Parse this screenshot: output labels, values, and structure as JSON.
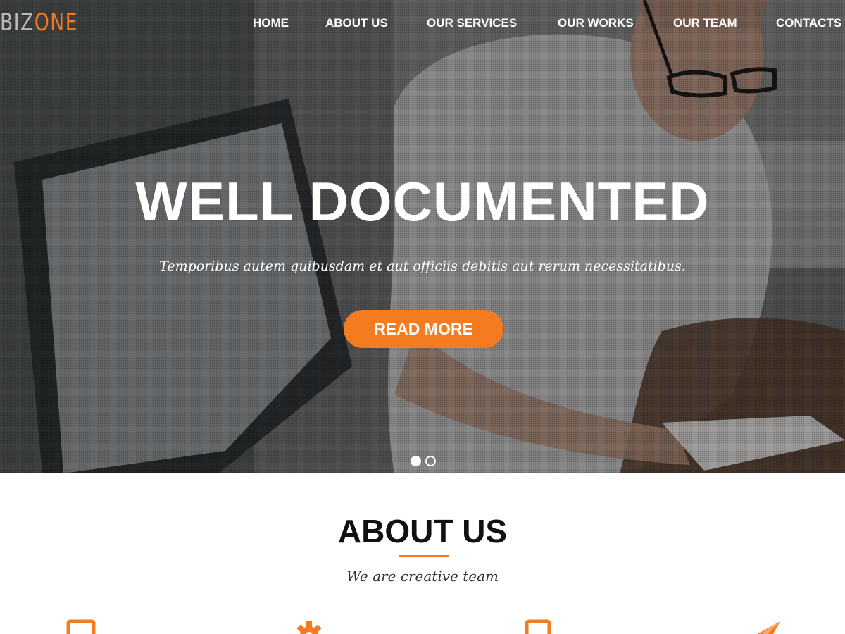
{
  "logo": {
    "part1": "BIZ",
    "part2": "ONE"
  },
  "nav": {
    "items": [
      {
        "label": "HOME"
      },
      {
        "label": "ABOUT US"
      },
      {
        "label": "OUR SERVICES"
      },
      {
        "label": "OUR WORKS"
      },
      {
        "label": "OUR TEAM"
      },
      {
        "label": "CONTACTS"
      }
    ]
  },
  "hero": {
    "title": "WELL DOCUMENTED",
    "subtitle": "Temporibus autem quibusdam et aut officiis debitis aut rerum necessitatibus.",
    "button_label": "READ MORE",
    "slides_total": 2,
    "active_slide": 1
  },
  "about": {
    "title": "ABOUT US",
    "subtitle": "We are creative team"
  },
  "features": {
    "icons": [
      "tablet-icon",
      "gear-icon",
      "tablet-icon",
      "paper-plane-icon"
    ]
  },
  "colors": {
    "accent": "#f47b20",
    "logo_gray": "#b9b9b9",
    "text_dark": "#111111",
    "white": "#ffffff"
  }
}
